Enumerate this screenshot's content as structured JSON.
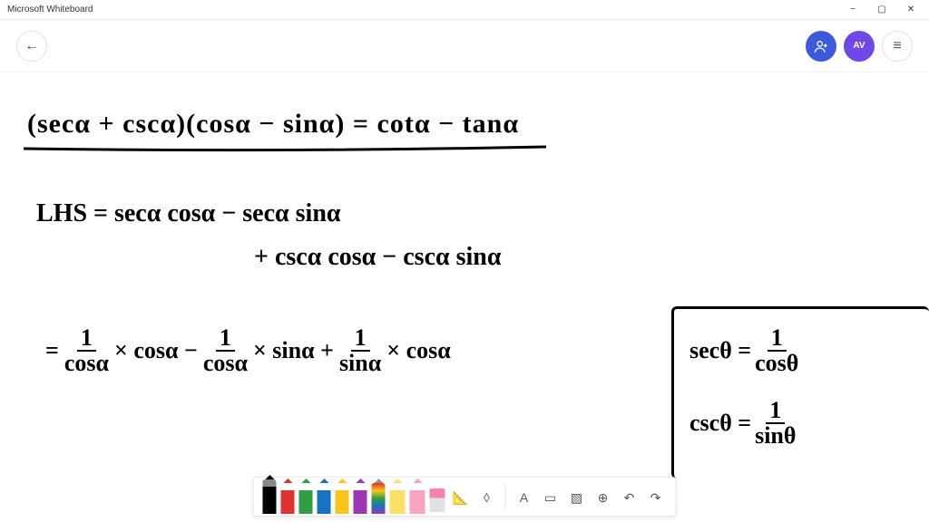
{
  "window": {
    "title": "Microsoft Whiteboard",
    "minimize": "−",
    "maximize": "▢",
    "close": "✕"
  },
  "topbar": {
    "back_icon": "←",
    "invite_icon": "👤",
    "avatar_initials": "AV",
    "menu_icon": "≡"
  },
  "handwriting": {
    "line1": "(secα + cscα)(cosα − sinα) = cotα − tanα",
    "line2": "LHS =    secα cosα − secα sinα",
    "line3": "+ cscα cosα  − cscα sinα",
    "line4_pre": "= ",
    "line4_f1n": "1",
    "line4_f1d": "cosα",
    "line4_m1": " × cosα − ",
    "line4_f2n": "1",
    "line4_f2d": "cosα",
    "line4_m2": " × sinα + ",
    "line4_f3n": "1",
    "line4_f3d": "sinα",
    "line4_m3": " × cosα",
    "box1_lhs": "secθ = ",
    "box1_fn": "1",
    "box1_fd": "cosθ",
    "box2_lhs": "cscθ = ",
    "box2_fn": "1",
    "box2_fd": "sinθ"
  },
  "toolbar": {
    "ruler": "📐",
    "lasso": "◊",
    "text": "A",
    "note": "▭",
    "image": "▧",
    "add": "⊕",
    "undo": "↶",
    "redo": "↷"
  }
}
